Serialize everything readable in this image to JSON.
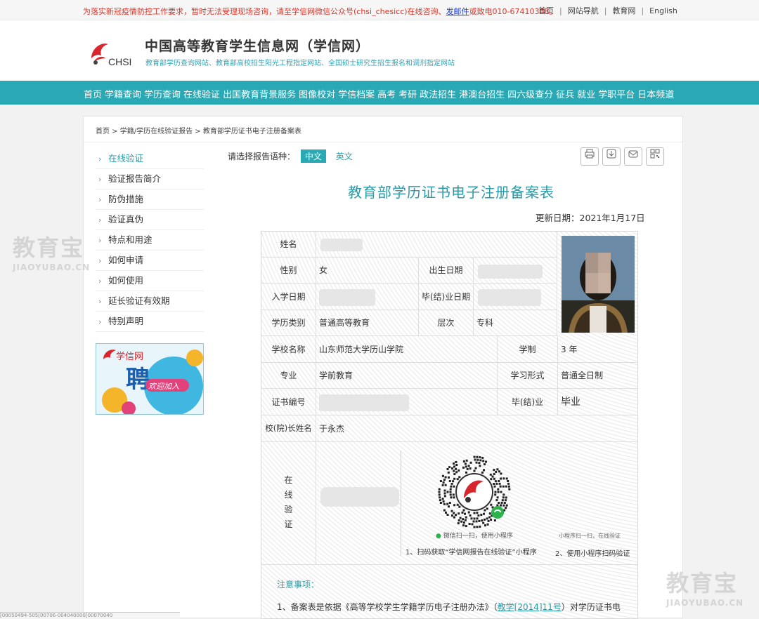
{
  "topbar": {
    "notice_pre": "为落实新冠疫情防控工作要求，暂时无法受理现场咨询，请至学信网微信公众号(chsi_chesicc)在线咨询、",
    "notice_link": "发邮件",
    "notice_post": "或致电010-67410388。",
    "links": [
      "首页",
      "网站导航",
      "教育网",
      "English"
    ]
  },
  "header": {
    "logo_text": "CHSI",
    "title": "中国高等教育学生信息网（学信网）",
    "subtitle": "教育部学历查询网站、教育部高校招生阳光工程指定网站、全国硕士研究生招生报名和调剂指定网站"
  },
  "nav": [
    "首页",
    "学籍查询",
    "学历查询",
    "在线验证",
    "出国教育背景服务",
    "图像校对",
    "学信档案",
    "高考",
    "考研",
    "政法招生",
    "港澳台招生",
    "四六级查分",
    "征兵",
    "就业",
    "学职平台",
    "日本频道"
  ],
  "breadcrumb": "首页 > 学籍/学历在线验证报告 > 教育部学历证书电子注册备案表",
  "sidebar": [
    {
      "label": "在线验证",
      "active": true
    },
    {
      "label": "验证报告简介",
      "active": false
    },
    {
      "label": "防伪措施",
      "active": false
    },
    {
      "label": "验证真伪",
      "active": false
    },
    {
      "label": "特点和用途",
      "active": false
    },
    {
      "label": "如何申请",
      "active": false
    },
    {
      "label": "如何使用",
      "active": false
    },
    {
      "label": "延长验证有效期",
      "active": false
    },
    {
      "label": "特别声明",
      "active": false
    }
  ],
  "recruit": {
    "brand": "学信网",
    "big": "聘",
    "sub": "欢迎加入"
  },
  "lang": {
    "prompt": "请选择报告语种：",
    "zh": "中文",
    "en": "英文"
  },
  "tools": {
    "print": "print-icon",
    "download": "download-icon",
    "mail": "mail-icon",
    "qrcode": "qrcode-icon"
  },
  "doc": {
    "title": "教育部学历证书电子注册备案表",
    "update": "更新日期：2021年1月17日"
  },
  "table": {
    "name_label": "姓名",
    "gender_label": "性别",
    "gender_value": "女",
    "birth_label": "出生日期",
    "enroll_label": "入学日期",
    "grad_label": "毕(结)业日期",
    "category_label": "学历类别",
    "category_value": "普通高等教育",
    "level_label": "层次",
    "level_value": "专科",
    "school_label": "学校名称",
    "school_value": "山东师范大学历山学院",
    "duration_label": "学制",
    "duration_value": "3 年",
    "major_label": "专业",
    "major_value": "学前教育",
    "form_label": "学习形式",
    "form_value": "普通全日制",
    "cert_label": "证书编号",
    "result_label": "毕(结)业",
    "result_value": "毕业",
    "president_label": "校(院)长姓名",
    "president_value": "于永杰",
    "verify_label": [
      "在",
      "线",
      "验",
      "证"
    ],
    "qr_caption": "微信扫一扫，使用小程序",
    "qr_caption2": "小程序扫一扫，在线验证",
    "step1": "1、扫码获取“学信网报告在线验证”小程序",
    "step2": "2、使用小程序扫码验证"
  },
  "notes": {
    "heading": "注意事项：",
    "item1_pre": "1、备案表是依据《高等学校学生学籍学历电子注册办法》（",
    "item1_link": "教学[2014]11号",
    "item1_post": "）对学历证书电"
  },
  "watermark": {
    "big": "教育宝",
    "small": "JIAOYUBAO.CN"
  },
  "bottom_status": "[00050494-505[00706-004040000[00070040"
}
